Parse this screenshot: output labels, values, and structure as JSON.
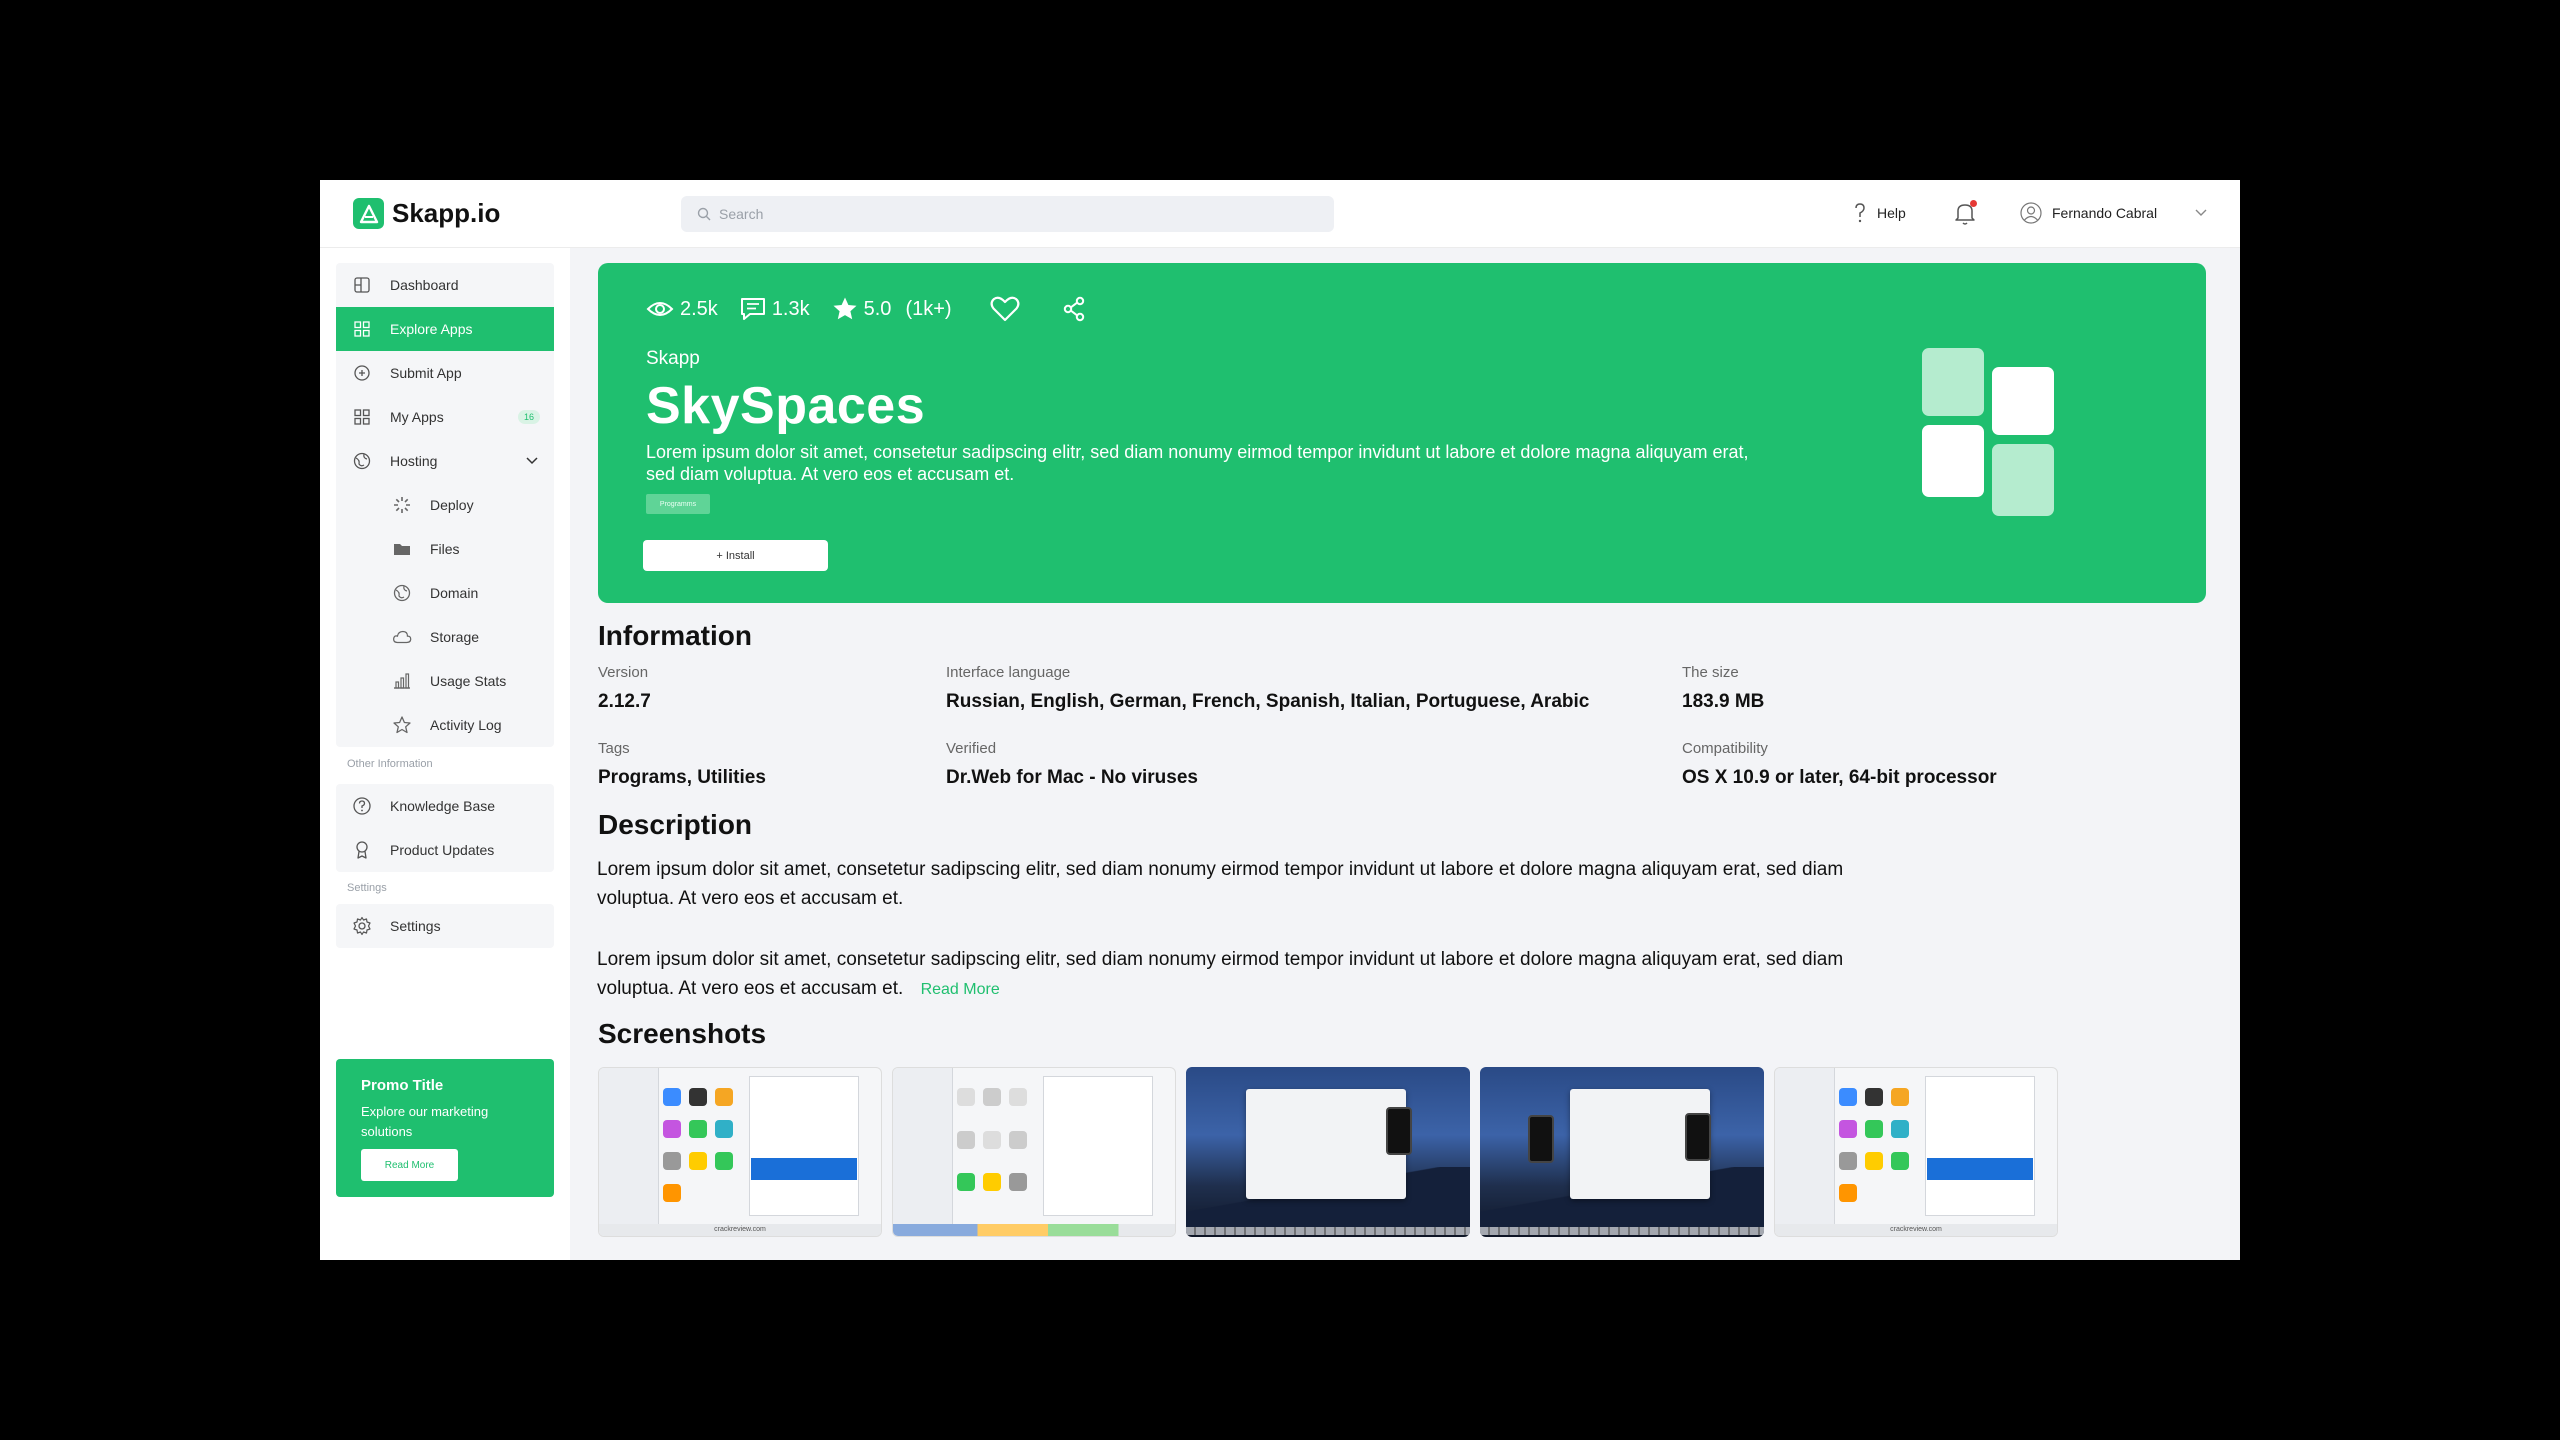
{
  "app": {
    "brand": "Skapp.io"
  },
  "header": {
    "search_placeholder": "Search",
    "help_label": "Help",
    "user_name": "Fernando Cabral"
  },
  "sidebar": {
    "items": [
      {
        "label": "Dashboard"
      },
      {
        "label": "Explore Apps"
      },
      {
        "label": "Submit App"
      },
      {
        "label": "My Apps",
        "badge": "16"
      },
      {
        "label": "Hosting"
      }
    ],
    "hosting_items": [
      {
        "label": "Deploy"
      },
      {
        "label": "Files"
      },
      {
        "label": "Domain"
      },
      {
        "label": "Storage"
      },
      {
        "label": "Usage Stats"
      },
      {
        "label": "Activity Log"
      }
    ],
    "other_section_label": "Other Information",
    "other_items": [
      {
        "label": "Knowledge Base"
      },
      {
        "label": "Product Updates"
      }
    ],
    "settings_section_label": "Settings",
    "settings_items": [
      {
        "label": "Settings"
      }
    ],
    "promo": {
      "title": "Promo Title",
      "text": "Explore our marketing solutions",
      "button": "Read More"
    }
  },
  "hero": {
    "views": "2.5k",
    "comments": "1.3k",
    "rating": "5.0",
    "rating_count": "(1k+)",
    "publisher": "Skapp",
    "title": "SkySpaces",
    "description": "Lorem ipsum dolor sit amet, consetetur sadipscing elitr, sed diam nonumy eirmod tempor invidunt ut labore et dolore magna aliquyam erat, sed diam voluptua. At vero eos et accusam et.",
    "tag": "Programms",
    "install_label": "+ Install",
    "accent_color": "#1fbf6f"
  },
  "information": {
    "heading": "Information",
    "version_label": "Version",
    "version_value": "2.12.7",
    "language_label": "Interface language",
    "language_value": "Russian, English, German, French, Spanish, Italian, Portuguese, Arabic",
    "size_label": "The size",
    "size_value": "183.9 MB",
    "tags_label": "Tags",
    "tags_value": "Programs, Utilities",
    "verified_label": "Verified",
    "verified_value": "Dr.Web for Mac - No viruses",
    "compat_label": "Compatibility",
    "compat_value": "OS X 10.9 or later, 64-bit processor"
  },
  "description": {
    "heading": "Description",
    "paragraph_1": "Lorem ipsum dolor sit amet, consetetur sadipscing elitr, sed diam nonumy eirmod tempor invidunt ut labore et dolore magna aliquyam erat, sed diam voluptua. At vero eos et accusam et.",
    "paragraph_2": "Lorem ipsum dolor sit amet, consetetur sadipscing elitr, sed diam nonumy eirmod tempor invidunt ut labore et dolore magna aliquyam erat, sed diam voluptua. At vero eos et accusam et.",
    "read_more": "Read More"
  },
  "screenshots": {
    "heading": "Screenshots",
    "caption": "crackreview.com",
    "items": [
      "light",
      "light",
      "dark",
      "dark",
      "light"
    ]
  }
}
